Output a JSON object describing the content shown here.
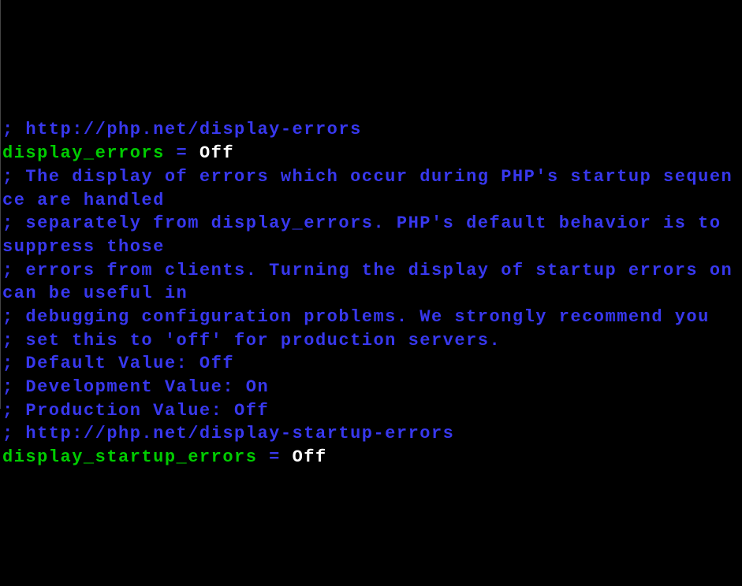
{
  "lines": {
    "l1_comment": "; http://php.net/display-errors",
    "l2_key": "display_errors",
    "l2_eq": " = ",
    "l2_value": "Off",
    "l3_blank": "",
    "l4_comment": "; The display of errors which occur during PHP's startup sequence are handled",
    "l5_comment": "; separately from display_errors. PHP's default behavior is to suppress those",
    "l6_comment": "; errors from clients. Turning the display of startup errors on can be useful in",
    "l7_comment": "; debugging configuration problems. We strongly recommend you",
    "l8_comment": "; set this to 'off' for production servers.",
    "l9_comment": "; Default Value: Off",
    "l10_comment": "; Development Value: On",
    "l11_comment": "; Production Value: Off",
    "l12_comment": "; http://php.net/display-startup-errors",
    "l13_key": "display_startup_errors",
    "l13_eq": " = ",
    "l13_value": "Off"
  }
}
